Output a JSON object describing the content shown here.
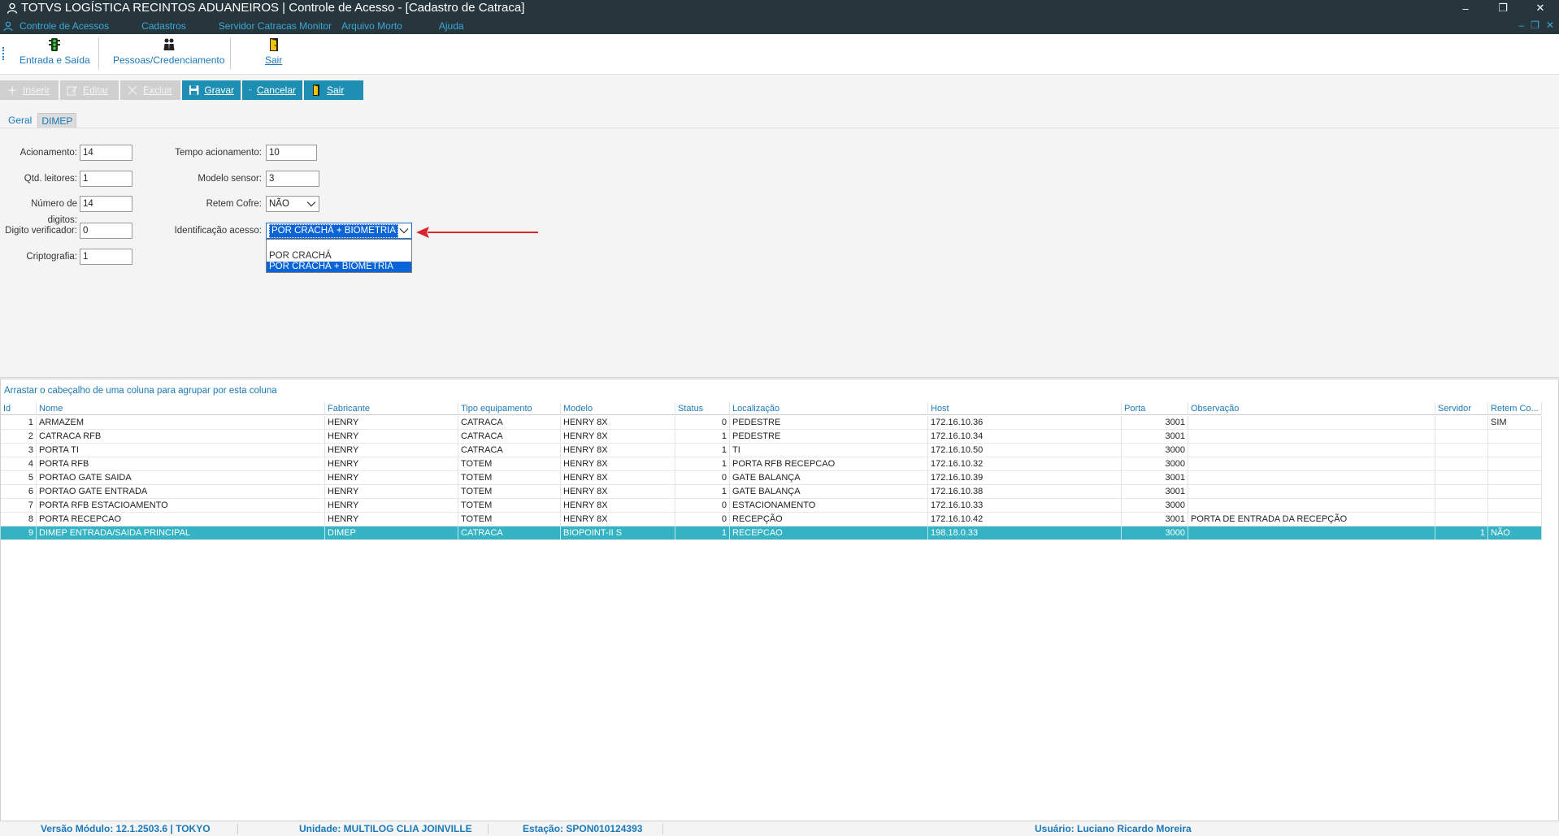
{
  "window": {
    "title": "TOTVS LOGÍSTICA RECINTOS ADUANEIROS | Controle de Acesso - [Cadastro de Catraca]",
    "controls": {
      "minimize": "–",
      "restore": "❐",
      "close": "✕"
    },
    "mdi_controls": {
      "minimize": "–",
      "restore": "❐",
      "close": "✕"
    }
  },
  "menu": [
    "Controle de Acessos",
    "Cadastros",
    "Servidor Catracas Monitor",
    "Arquivo Morto",
    "Ajuda"
  ],
  "toolbar": {
    "entrada_saida": "Entrada e Saída",
    "pessoas": "Pessoas/Credenciamento",
    "sair": "Sair"
  },
  "actions": {
    "inserir": "Inserir",
    "editar": "Editar",
    "excluir": "Excluir",
    "gravar": "Gravar",
    "cancelar": "Cancelar",
    "sair": "Sair"
  },
  "tabs": {
    "geral": "Geral",
    "dimep": "DIMEP"
  },
  "form": {
    "acionamento_label": "Acionamento:",
    "acionamento_value": "14",
    "qtd_leitores_label": "Qtd. leitores:",
    "qtd_leitores_value": "1",
    "numero_digitos_label": "Número de digitos:",
    "numero_digitos_value": "14",
    "digito_verificador_label": "Digito verificador:",
    "digito_verificador_value": "0",
    "criptografia_label": "Criptografia:",
    "criptografia_value": "1",
    "tempo_acionamento_label": "Tempo acionamento:",
    "tempo_acionamento_value": "10",
    "modelo_sensor_label": "Modelo sensor:",
    "modelo_sensor_value": "3",
    "retem_cofre_label": "Retem Cofre:",
    "retem_cofre_value": "NÃO",
    "identificacao_label": "Identificação acesso:",
    "identificacao_value": "POR CRACHÁ + BIOMETRIA",
    "identificacao_options": [
      "",
      "POR CRACHÁ",
      "POR CRACHÁ + BIOMETRIA"
    ]
  },
  "grid": {
    "group_hint": "Arrastar o cabeçalho de uma coluna para agrupar por esta coluna",
    "columns": [
      "Id",
      "Nome",
      "Fabricante",
      "Tipo equipamento",
      "Modelo",
      "Status",
      "Localização",
      "Host",
      "Porta",
      "Observação",
      "Servidor",
      "Retem Co..."
    ],
    "rows": [
      [
        "1",
        "ARMAZEM",
        "HENRY",
        "CATRACA",
        "HENRY 8X",
        "0",
        "PEDESTRE",
        "172.16.10.36",
        "3001",
        "",
        "",
        "SIM"
      ],
      [
        "2",
        "CATRACA RFB",
        "HENRY",
        "CATRACA",
        "HENRY 8X",
        "1",
        "PEDESTRE",
        "172.16.10.34",
        "3001",
        "",
        "",
        ""
      ],
      [
        "3",
        "PORTA TI",
        "HENRY",
        "CATRACA",
        "HENRY 8X",
        "1",
        "TI",
        "172.16.10.50",
        "3000",
        "",
        "",
        ""
      ],
      [
        "4",
        "PORTA RFB",
        "HENRY",
        "TOTEM",
        "HENRY 8X",
        "1",
        "PORTA RFB RECEPCAO",
        "172.16.10.32",
        "3000",
        "",
        "",
        ""
      ],
      [
        "5",
        "PORTAO GATE SAIDA",
        "HENRY",
        "TOTEM",
        "HENRY 8X",
        "0",
        "GATE BALANÇA",
        "172.16.10.39",
        "3001",
        "",
        "",
        ""
      ],
      [
        "6",
        "PORTAO GATE ENTRADA",
        "HENRY",
        "TOTEM",
        "HENRY 8X",
        "1",
        "GATE BALANÇA",
        "172.16.10.38",
        "3001",
        "",
        "",
        ""
      ],
      [
        "7",
        "PORTA RFB ESTACIOAMENTO",
        "HENRY",
        "TOTEM",
        "HENRY 8X",
        "0",
        "ESTACIONAMENTO",
        "172.16.10.33",
        "3000",
        "",
        "",
        ""
      ],
      [
        "8",
        "PORTA RECEPCAO",
        "HENRY",
        "TOTEM",
        "HENRY 8X",
        "0",
        "RECEPÇÃO",
        "172.16.10.42",
        "3001",
        "PORTA DE ENTRADA DA RECEPÇÃO",
        "",
        ""
      ],
      [
        "9",
        "DIMEP ENTRADA/SAIDA PRINCIPAL",
        "DIMEP",
        "CATRACA",
        "BIOPOINT-II S",
        "1",
        "RECEPCAO",
        "198.18.0.33",
        "3000",
        "",
        "1",
        "NÃO"
      ]
    ]
  },
  "status": {
    "versao": "Versão Módulo:   12.1.2503.6  |  TOKYO",
    "unidade": "Unidade: MULTILOG CLIA JOINVILLE",
    "estacao": "Estação: SPON010124393",
    "usuario": "Usuário: Luciano Ricardo Moreira"
  },
  "colors": {
    "titlebar": "#27363d",
    "accent": "#1a79b8",
    "button_enabled": "#1e8fb3",
    "selected_row": "#34b3c4",
    "selection_blue": "#0a64d6",
    "arrow": "#d9262b"
  }
}
